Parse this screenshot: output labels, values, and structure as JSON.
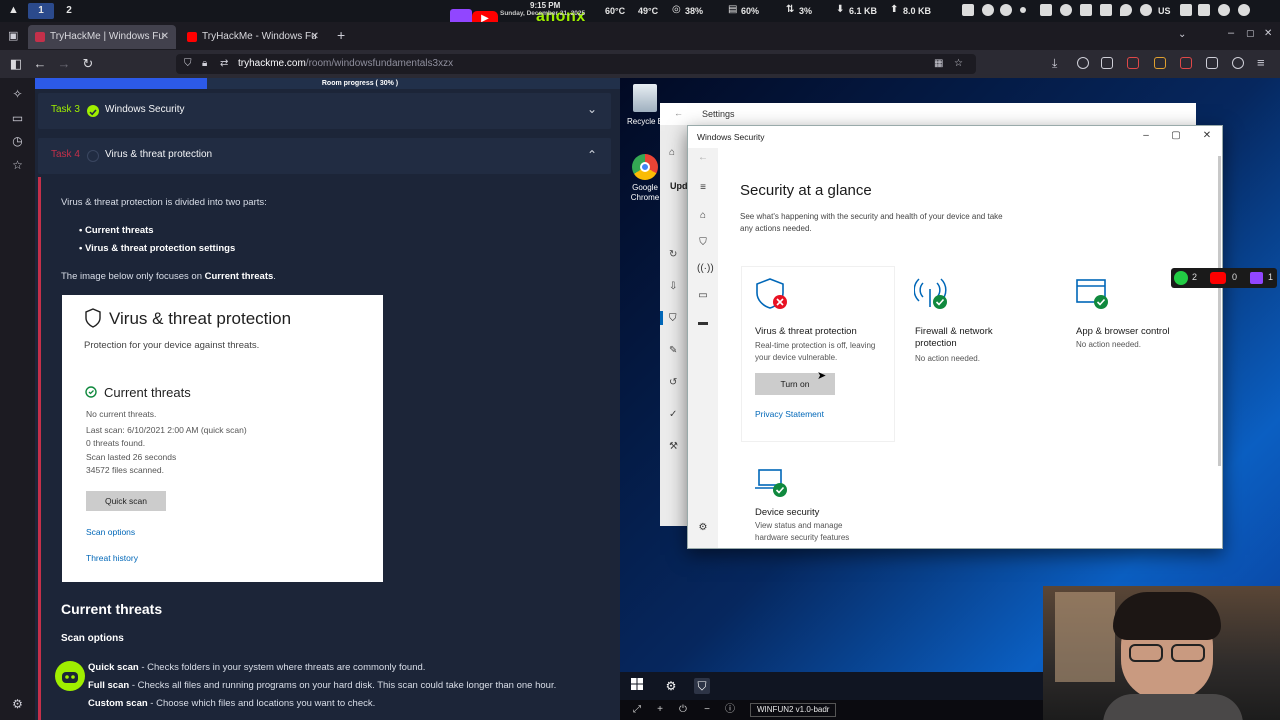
{
  "system_bar": {
    "workspaces": [
      "1",
      "2"
    ],
    "clock_time": "9:15 PM",
    "clock_date": "Sunday, December 21, 2025",
    "cpu_temp": "60°C",
    "gpu_temp": "49°C",
    "cpu_usage": "38%",
    "mem_usage": "60%",
    "disk_usage": "3%",
    "net_down": "6.1 KB",
    "net_up": "8.0 KB",
    "keyboard_layout": "US",
    "logo_text": "anonx"
  },
  "browser": {
    "tabs": [
      {
        "title": "TryHackMe | Windows Fu",
        "fav_color": "#c4304a",
        "active": true
      },
      {
        "title": "TryHackMe - Windows Fu",
        "fav_color": "#ff0000",
        "active": false
      }
    ],
    "url_host": "tryhackme.com",
    "url_path": "/room/windowsfundamentals3xzx"
  },
  "room": {
    "progress_label": "Room progress ( 30% )",
    "progress_pct": 30,
    "task3": {
      "number": "Task 3",
      "title": "Windows Security",
      "done": true
    },
    "task4": {
      "number": "Task 4",
      "title": "Virus & threat protection",
      "done": false
    },
    "intro": "Virus & threat protection is divided into two parts:",
    "bullets": [
      "Current threats",
      "Virus & threat protection settings"
    ],
    "image_note_prefix": "The image below only focuses on ",
    "image_note_bold": "Current threats",
    "image_note_suffix": ".",
    "screenshot": {
      "title": "Virus & threat protection",
      "subtitle": "Protection for your device against threats.",
      "section": "Current threats",
      "lines": [
        "No current threats.",
        "Last scan: 6/10/2021 2:00 AM (quick scan)",
        "0 threats found.",
        "Scan lasted 26 seconds",
        "34572 files scanned."
      ],
      "quick_scan": "Quick scan",
      "scan_options": "Scan options",
      "threat_history": "Threat history"
    },
    "current_threats_heading": "Current threats",
    "scan_options_heading": "Scan options",
    "scan_items": [
      {
        "name": "Quick scan",
        "desc": " - Checks folders in your system where threats are commonly found."
      },
      {
        "name": "Full scan",
        "desc": " - Checks all files and running programs on your hard disk. This scan could take longer than one hour."
      },
      {
        "name": "Custom scan",
        "desc": " - Choose which files and locations you want to check."
      }
    ]
  },
  "desktop": {
    "icons": [
      "Recycle B",
      "Google Chrome"
    ],
    "settings_title": "Settings",
    "settings_partial": "Upd",
    "windows_security": {
      "window_title": "Windows Security",
      "heading": "Security at a glance",
      "subheading": "See what's happening with the security and health of your device and take any actions needed.",
      "cards": [
        {
          "title": "Virus & threat protection",
          "desc": "Real-time protection is off, leaving your device vulnerable.",
          "status": "error",
          "button": "Turn on",
          "link": "Privacy Statement"
        },
        {
          "title": "Firewall & network protection",
          "desc": "No action needed.",
          "status": "ok"
        },
        {
          "title": "App & browser control",
          "desc": "No action needed.",
          "status": "ok"
        },
        {
          "title": "Device security",
          "desc": "View status and manage hardware security features",
          "status": "ok"
        }
      ]
    },
    "vm_label": "WINFUN2 v1.0-badr"
  },
  "overlay": {
    "counts": [
      "2",
      "0",
      "1"
    ]
  },
  "colors": {
    "thm_green": "#9fef00",
    "task_red": "#c4304a",
    "progress_blue": "#2c5ae8",
    "win_link": "#0067b8",
    "win_error": "#e81123",
    "win_ok": "#10893e"
  }
}
